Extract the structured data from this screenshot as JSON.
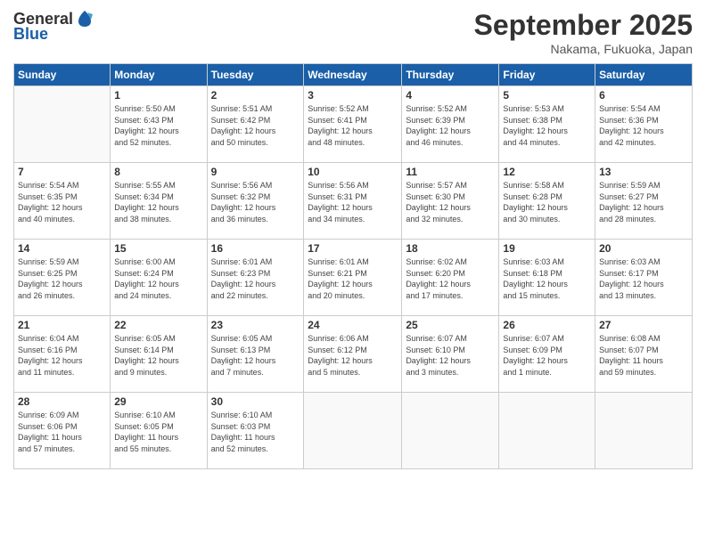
{
  "logo": {
    "general": "General",
    "blue": "Blue"
  },
  "header": {
    "month": "September 2025",
    "location": "Nakama, Fukuoka, Japan"
  },
  "days_of_week": [
    "Sunday",
    "Monday",
    "Tuesday",
    "Wednesday",
    "Thursday",
    "Friday",
    "Saturday"
  ],
  "weeks": [
    [
      {
        "day": "",
        "info": ""
      },
      {
        "day": "1",
        "info": "Sunrise: 5:50 AM\nSunset: 6:43 PM\nDaylight: 12 hours\nand 52 minutes."
      },
      {
        "day": "2",
        "info": "Sunrise: 5:51 AM\nSunset: 6:42 PM\nDaylight: 12 hours\nand 50 minutes."
      },
      {
        "day": "3",
        "info": "Sunrise: 5:52 AM\nSunset: 6:41 PM\nDaylight: 12 hours\nand 48 minutes."
      },
      {
        "day": "4",
        "info": "Sunrise: 5:52 AM\nSunset: 6:39 PM\nDaylight: 12 hours\nand 46 minutes."
      },
      {
        "day": "5",
        "info": "Sunrise: 5:53 AM\nSunset: 6:38 PM\nDaylight: 12 hours\nand 44 minutes."
      },
      {
        "day": "6",
        "info": "Sunrise: 5:54 AM\nSunset: 6:36 PM\nDaylight: 12 hours\nand 42 minutes."
      }
    ],
    [
      {
        "day": "7",
        "info": "Sunrise: 5:54 AM\nSunset: 6:35 PM\nDaylight: 12 hours\nand 40 minutes."
      },
      {
        "day": "8",
        "info": "Sunrise: 5:55 AM\nSunset: 6:34 PM\nDaylight: 12 hours\nand 38 minutes."
      },
      {
        "day": "9",
        "info": "Sunrise: 5:56 AM\nSunset: 6:32 PM\nDaylight: 12 hours\nand 36 minutes."
      },
      {
        "day": "10",
        "info": "Sunrise: 5:56 AM\nSunset: 6:31 PM\nDaylight: 12 hours\nand 34 minutes."
      },
      {
        "day": "11",
        "info": "Sunrise: 5:57 AM\nSunset: 6:30 PM\nDaylight: 12 hours\nand 32 minutes."
      },
      {
        "day": "12",
        "info": "Sunrise: 5:58 AM\nSunset: 6:28 PM\nDaylight: 12 hours\nand 30 minutes."
      },
      {
        "day": "13",
        "info": "Sunrise: 5:59 AM\nSunset: 6:27 PM\nDaylight: 12 hours\nand 28 minutes."
      }
    ],
    [
      {
        "day": "14",
        "info": "Sunrise: 5:59 AM\nSunset: 6:25 PM\nDaylight: 12 hours\nand 26 minutes."
      },
      {
        "day": "15",
        "info": "Sunrise: 6:00 AM\nSunset: 6:24 PM\nDaylight: 12 hours\nand 24 minutes."
      },
      {
        "day": "16",
        "info": "Sunrise: 6:01 AM\nSunset: 6:23 PM\nDaylight: 12 hours\nand 22 minutes."
      },
      {
        "day": "17",
        "info": "Sunrise: 6:01 AM\nSunset: 6:21 PM\nDaylight: 12 hours\nand 20 minutes."
      },
      {
        "day": "18",
        "info": "Sunrise: 6:02 AM\nSunset: 6:20 PM\nDaylight: 12 hours\nand 17 minutes."
      },
      {
        "day": "19",
        "info": "Sunrise: 6:03 AM\nSunset: 6:18 PM\nDaylight: 12 hours\nand 15 minutes."
      },
      {
        "day": "20",
        "info": "Sunrise: 6:03 AM\nSunset: 6:17 PM\nDaylight: 12 hours\nand 13 minutes."
      }
    ],
    [
      {
        "day": "21",
        "info": "Sunrise: 6:04 AM\nSunset: 6:16 PM\nDaylight: 12 hours\nand 11 minutes."
      },
      {
        "day": "22",
        "info": "Sunrise: 6:05 AM\nSunset: 6:14 PM\nDaylight: 12 hours\nand 9 minutes."
      },
      {
        "day": "23",
        "info": "Sunrise: 6:05 AM\nSunset: 6:13 PM\nDaylight: 12 hours\nand 7 minutes."
      },
      {
        "day": "24",
        "info": "Sunrise: 6:06 AM\nSunset: 6:12 PM\nDaylight: 12 hours\nand 5 minutes."
      },
      {
        "day": "25",
        "info": "Sunrise: 6:07 AM\nSunset: 6:10 PM\nDaylight: 12 hours\nand 3 minutes."
      },
      {
        "day": "26",
        "info": "Sunrise: 6:07 AM\nSunset: 6:09 PM\nDaylight: 12 hours\nand 1 minute."
      },
      {
        "day": "27",
        "info": "Sunrise: 6:08 AM\nSunset: 6:07 PM\nDaylight: 11 hours\nand 59 minutes."
      }
    ],
    [
      {
        "day": "28",
        "info": "Sunrise: 6:09 AM\nSunset: 6:06 PM\nDaylight: 11 hours\nand 57 minutes."
      },
      {
        "day": "29",
        "info": "Sunrise: 6:10 AM\nSunset: 6:05 PM\nDaylight: 11 hours\nand 55 minutes."
      },
      {
        "day": "30",
        "info": "Sunrise: 6:10 AM\nSunset: 6:03 PM\nDaylight: 11 hours\nand 52 minutes."
      },
      {
        "day": "",
        "info": ""
      },
      {
        "day": "",
        "info": ""
      },
      {
        "day": "",
        "info": ""
      },
      {
        "day": "",
        "info": ""
      }
    ]
  ]
}
